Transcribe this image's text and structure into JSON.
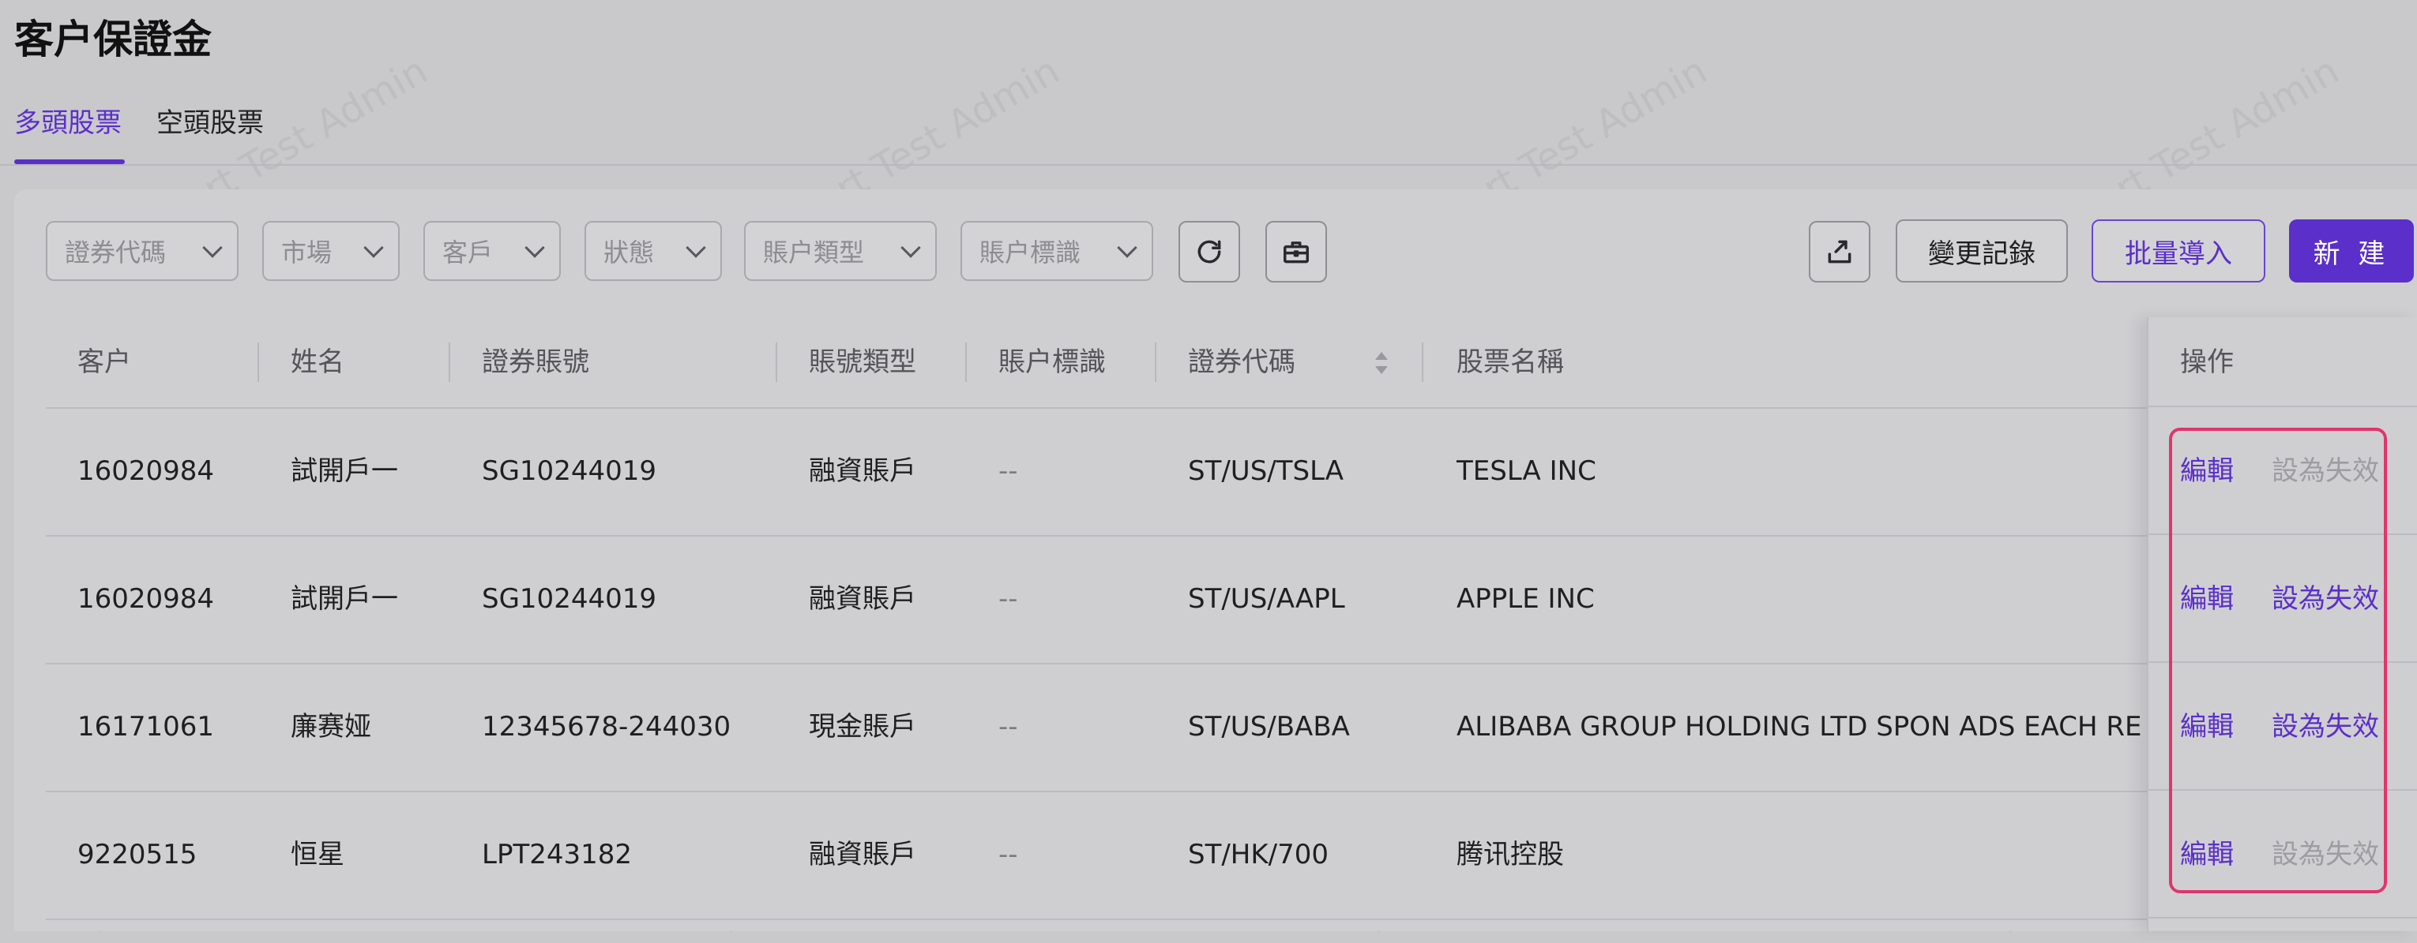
{
  "page_title": "客户保證金",
  "tabs": [
    {
      "label": "多頭股票",
      "active": true
    },
    {
      "label": "空頭股票",
      "active": false
    }
  ],
  "filters": [
    {
      "label": "證券代碼"
    },
    {
      "label": "市場"
    },
    {
      "label": "客戶"
    },
    {
      "label": "狀態"
    },
    {
      "label": "賬户類型"
    },
    {
      "label": "賬户標識"
    }
  ],
  "icons": {
    "refresh": "refresh-icon",
    "settings": "toolbox-icon",
    "export": "export-icon"
  },
  "actions": {
    "change_log": "變更記錄",
    "bulk_import": "批量導入",
    "create": "新 建"
  },
  "table": {
    "columns": [
      "客户",
      "姓名",
      "證券賬號",
      "賬號類型",
      "賬户標識",
      "證券代碼",
      "股票名稱",
      "操作"
    ],
    "rows": [
      {
        "client": "16020984",
        "name": "試開戶一",
        "account": "SG10244019",
        "type": "融資賬戶",
        "tag": "--",
        "code": "ST/US/TSLA",
        "stock": "TESLA INC",
        "edit": "編輯",
        "disable": "設為失效",
        "disable_enabled": false
      },
      {
        "client": "16020984",
        "name": "試開戶一",
        "account": "SG10244019",
        "type": "融資賬戶",
        "tag": "--",
        "code": "ST/US/AAPL",
        "stock": "APPLE INC",
        "edit": "編輯",
        "disable": "設為失效",
        "disable_enabled": true
      },
      {
        "client": "16171061",
        "name": "廉赛娅",
        "account": "12345678-244030",
        "type": "現金賬戶",
        "tag": "--",
        "code": "ST/US/BABA",
        "stock": "ALIBABA GROUP HOLDING LTD SPON ADS EACH REP",
        "edit": "編輯",
        "disable": "設為失效",
        "disable_enabled": true
      },
      {
        "client": "9220515",
        "name": "恒星",
        "account": "LPT243182",
        "type": "融資賬戶",
        "tag": "--",
        "code": "ST/HK/700",
        "stock": "腾讯控股",
        "edit": "編輯",
        "disable": "設為失效",
        "disable_enabled": false
      }
    ]
  },
  "colors": {
    "accent": "#5b2fc9",
    "highlight_border": "#e0356b"
  },
  "watermark": "LongPort Test Admin"
}
